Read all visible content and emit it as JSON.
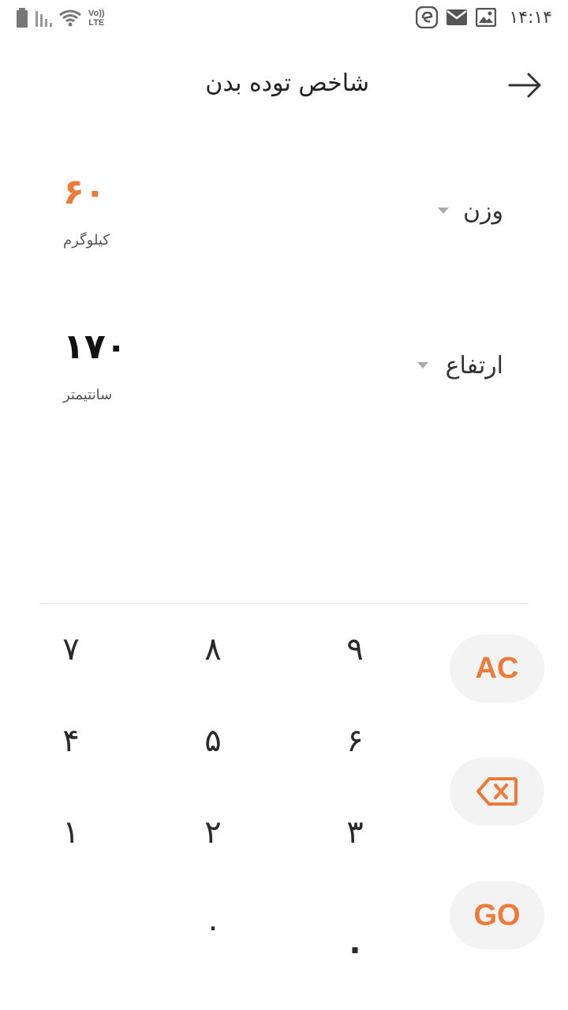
{
  "status_bar": {
    "time": "۱۴:۱۴",
    "lte_top": "Vo))",
    "lte_bottom": "LTE"
  },
  "header": {
    "title": "شاخص توده بدن"
  },
  "fields": {
    "weight": {
      "label": "وزن",
      "value": "۶۰",
      "unit": "کیلوگرم"
    },
    "height": {
      "label": "ارتفاع",
      "value": "۱۷۰",
      "unit": "سانتیمتر"
    }
  },
  "keypad": {
    "k7": "۷",
    "k8": "۸",
    "k9": "۹",
    "k4": "۴",
    "k5": "۵",
    "k6": "۶",
    "k1": "۱",
    "k2": "۲",
    "k3": "۳",
    "k0": "۰",
    "kdot": ".",
    "clear_label": "AC",
    "go_label": "GO"
  },
  "colors": {
    "accent": "#ee7a3a",
    "key_bg": "#f3f3f3",
    "divider": "#e2e2e2"
  },
  "icons": {
    "back": "arrow-right-icon",
    "backspace": "backspace-icon",
    "dropdown": "triangle-down-icon"
  }
}
